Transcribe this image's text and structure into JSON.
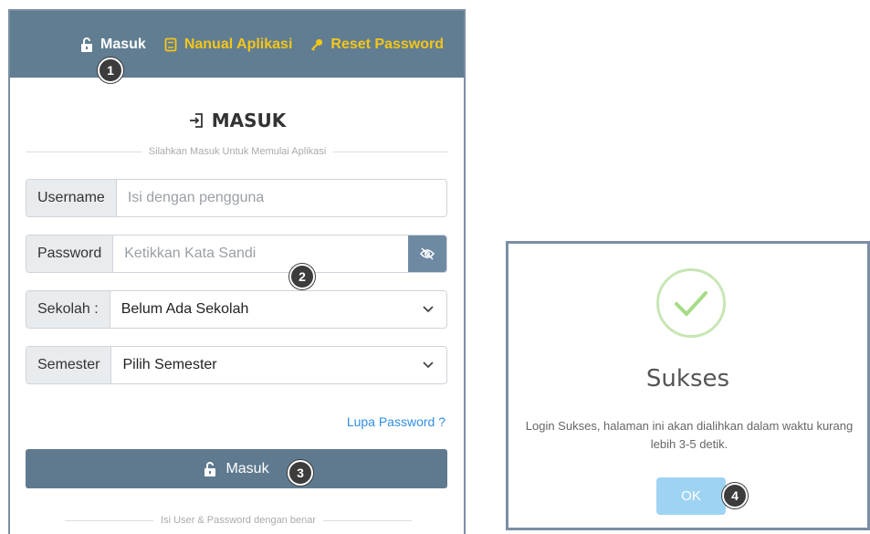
{
  "navbar": {
    "items": [
      {
        "label": "Masuk",
        "icon": "lock-open-icon",
        "active": true
      },
      {
        "label": "Nanual Aplikasi",
        "icon": "book-icon",
        "active": false
      },
      {
        "label": "Reset Password",
        "icon": "key-icon",
        "active": false
      }
    ],
    "background": "#607d92",
    "link_color": "#f5c518"
  },
  "markers": [
    "1",
    "2",
    "3",
    "4"
  ],
  "login": {
    "title": "MASUK",
    "subtitle": "Silahkan Masuk Untuk Memulai Aplikasi",
    "username": {
      "label": "Username",
      "placeholder": "Isi dengan pengguna"
    },
    "password": {
      "label": "Password",
      "placeholder": "Ketikkan Kata Sandi"
    },
    "school": {
      "label": "Sekolah :",
      "value": "Belum Ada Sekolah"
    },
    "semester": {
      "label": "Semester",
      "value": "Pilih Semester"
    },
    "forgot_link": "Lupa Password ?",
    "submit_label": "Masuk",
    "footer_note": "Isi User & Password dengan benar"
  },
  "dialog": {
    "title": "Sukses",
    "message": "Login Sukses, halaman ini akan dialihkan dalam waktu kurang lebih 3-5 detik.",
    "ok_label": "OK",
    "accent": "#a5dc86"
  }
}
